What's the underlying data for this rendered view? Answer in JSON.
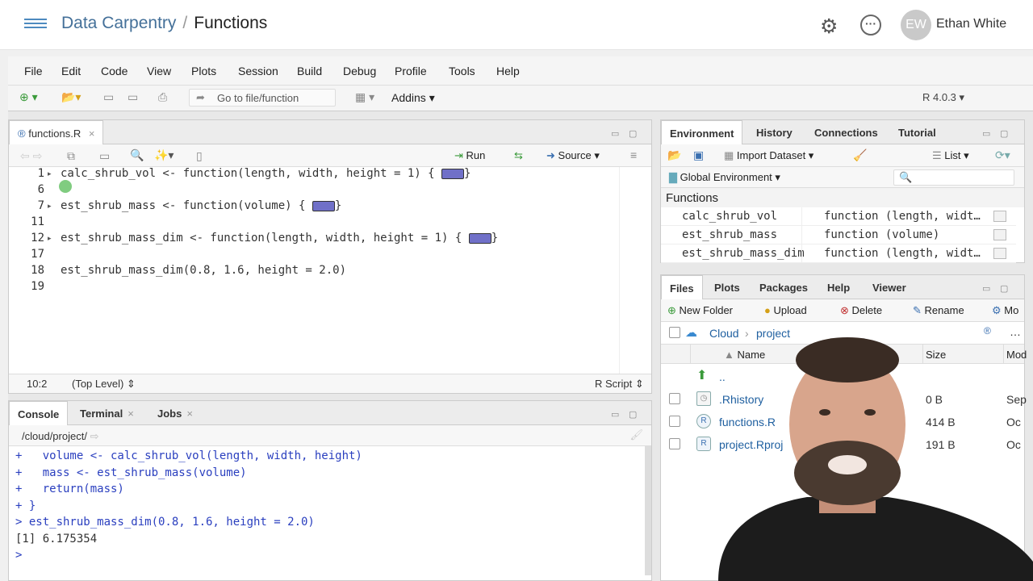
{
  "header": {
    "project": "Data Carpentry",
    "separator": "/",
    "page": "Functions",
    "avatar_initials": "EW",
    "username": "Ethan White"
  },
  "menubar": [
    "File",
    "Edit",
    "Code",
    "View",
    "Plots",
    "Session",
    "Build",
    "Debug",
    "Profile",
    "Tools",
    "Help"
  ],
  "toolbar": {
    "goto_placeholder": "Go to file/function",
    "addins": "Addins",
    "r_version": "R 4.0.3"
  },
  "editor": {
    "filename": "functions.R",
    "run": "Run",
    "source": "Source",
    "lines": [
      {
        "n": "1",
        "code": "calc_shrub_vol <- function(length, width, height = 1) {"
      },
      {
        "n": "6",
        "code": ""
      },
      {
        "n": "7",
        "code": "est_shrub_mass <- function(volume) {"
      },
      {
        "n": "11",
        "code": ""
      },
      {
        "n": "12",
        "code": "est_shrub_mass_dim <- function(length, width, height = 1) {"
      },
      {
        "n": "17",
        "code": ""
      },
      {
        "n": "18",
        "code": "est_shrub_mass_dim(0.8, 1.6, height = 2.0)"
      },
      {
        "n": "19",
        "code": ""
      }
    ],
    "status_position": "10:2",
    "status_scope": "(Top Level)",
    "status_type": "R Script"
  },
  "console": {
    "tabs": [
      "Console",
      "Terminal",
      "Jobs"
    ],
    "path": "/cloud/project/",
    "lines": [
      "+   volume <- calc_shrub_vol(length, width, height)",
      "+   mass <- est_shrub_mass(volume)",
      "+   return(mass)",
      "+ }",
      "> est_shrub_mass_dim(0.8, 1.6, height = 2.0)",
      "[1] 6.175354",
      "> "
    ]
  },
  "environment": {
    "tabs": [
      "Environment",
      "History",
      "Connections",
      "Tutorial"
    ],
    "import_dataset": "Import Dataset",
    "list_view": "List",
    "scope": "Global Environment",
    "section": "Functions",
    "rows": [
      {
        "name": "calc_shrub_vol",
        "value": "function (length, widt…"
      },
      {
        "name": "est_shrub_mass",
        "value": "function (volume)"
      },
      {
        "name": "est_shrub_mass_dim",
        "value": "function (length, widt…"
      }
    ]
  },
  "files": {
    "tabs": [
      "Files",
      "Plots",
      "Packages",
      "Help",
      "Viewer"
    ],
    "new_folder": "New Folder",
    "upload": "Upload",
    "delete": "Delete",
    "rename": "Rename",
    "more_cut": "Mo",
    "path_root": "Cloud",
    "path_dir": "project",
    "more_dots": "…",
    "col_name": "Name",
    "col_size": "Size",
    "col_modified": "Mod",
    "parent": "..",
    "rows": [
      {
        "name": ".Rhistory",
        "size": "0 B",
        "modified": "Sep"
      },
      {
        "name": "functions.R",
        "size": "414 B",
        "modified": "Oc"
      },
      {
        "name": "project.Rproj",
        "size": "191 B",
        "modified": "Oc"
      }
    ]
  },
  "colors": {
    "link": "#447099",
    "keyword": "#2a3fbf",
    "fold_chip": "#7070c8"
  }
}
